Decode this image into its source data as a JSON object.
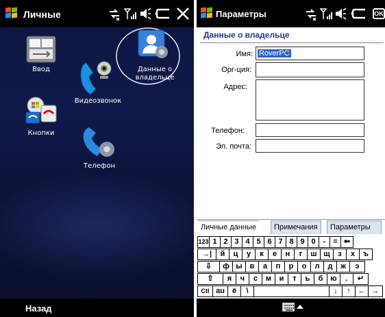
{
  "left": {
    "title": "Личные",
    "icons": [
      {
        "label": "Ввод",
        "icon": "input-icon"
      },
      {
        "label": "Видеозвонок",
        "icon": "video-call-icon"
      },
      {
        "label": "Данные о владельце",
        "icon": "owner-info-icon"
      },
      {
        "label": "Кнопки",
        "icon": "buttons-icon"
      },
      {
        "label": "Телефон",
        "icon": "phone-settings-icon"
      }
    ],
    "soft_left": "Назад"
  },
  "right": {
    "title": "Параметры",
    "ok": "OK",
    "section": "Данные о владельце",
    "fields": {
      "name_label": "Имя:",
      "name_value": "RoverPC",
      "org_label": "Орг-ция:",
      "org_value": "",
      "address_label": "Адрес:",
      "address_value": "",
      "phone_label": "Телефон:",
      "phone_value": "",
      "email_label": "Эл. почта:",
      "email_value": ""
    },
    "tabs": [
      "Личные данные",
      "Примечания",
      "Параметры"
    ],
    "keyboard": {
      "row1": [
        "123",
        "1",
        "2",
        "3",
        "4",
        "5",
        "6",
        "7",
        "8",
        "9",
        "0",
        "-",
        "=",
        "⬅"
      ],
      "row2": [
        "→|",
        "й",
        "ц",
        "у",
        "к",
        "е",
        "н",
        "г",
        "ш",
        "щ",
        "з",
        "х",
        "ъ"
      ],
      "row3": [
        "⇩",
        "ф",
        "ы",
        "в",
        "а",
        "п",
        "р",
        "о",
        "л",
        "д",
        "ж",
        "э"
      ],
      "row4": [
        "⇧",
        "я",
        "ч",
        "с",
        "м",
        "и",
        "т",
        "ь",
        "б",
        "ю",
        ".",
        "↵"
      ],
      "row5": [
        "Ctl",
        "аu",
        "ё",
        "\\",
        "",
        "↓",
        "↑",
        "←",
        "→"
      ]
    }
  },
  "colors": {
    "desktop_bg": "#0d1640",
    "section_title": "#1a3a8a",
    "selection": "#3163c8",
    "tab_inactive": "#d9e3f2"
  }
}
